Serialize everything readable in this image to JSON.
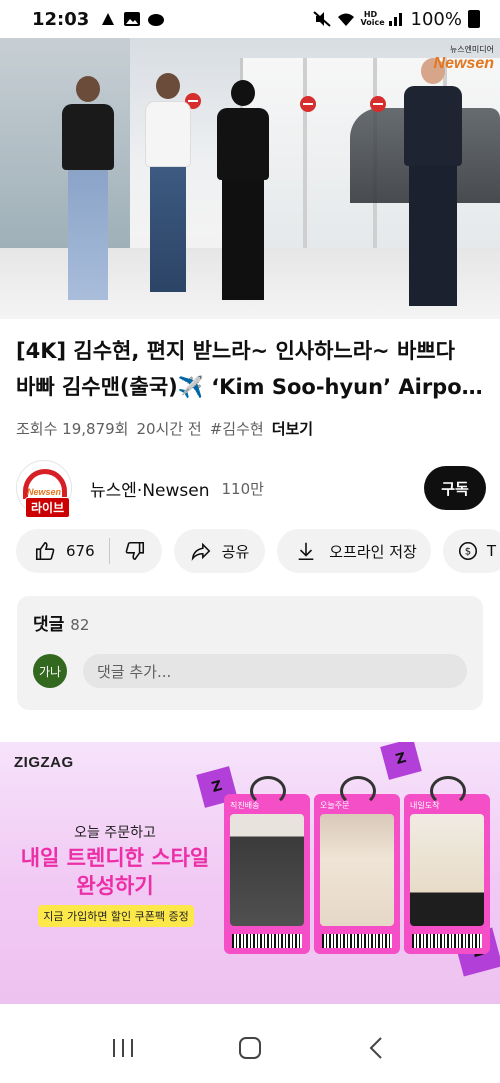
{
  "status_bar": {
    "time": "12:03",
    "battery": "100%",
    "network_badge": "HD Voice"
  },
  "video": {
    "watermark_small": "뉴스엔미디어",
    "watermark_brand": "Newsen"
  },
  "video_info": {
    "title_line1": "[4K] 김수현, 편지 받느라~ 인사하느라~ 바쁘다",
    "title_line2": "바빠 김수맨(출국)✈️ ‘Kim Soo-hyun’ Airpor...",
    "views": "조회수 19,879회",
    "time_ago": "20시간 전",
    "hashtag": "#김수현",
    "more_label": "더보기"
  },
  "channel": {
    "avatar_text": "Newsen",
    "live_badge": "라이브",
    "name": "뉴스엔·Newsen",
    "subscribers": "110만",
    "subscribe_label": "구독"
  },
  "actions": {
    "like_count": "676",
    "share_label": "공유",
    "download_label": "오프라인 저장",
    "thanks_label": "T"
  },
  "comments": {
    "header": "댓글",
    "count": "82",
    "user_avatar_text": "가나",
    "input_placeholder": "댓글 추가..."
  },
  "ad": {
    "brand": "ZIGZAG",
    "line1": "오늘 주문하고",
    "line2": "내일 트렌디한 스타일",
    "line3": "완성하기",
    "cta": "지금 가입하면 할인 쿠폰팩 증정",
    "ticket_tags": [
      "직진배송",
      "오늘주문",
      "내일도착"
    ],
    "accent_color": "#ec2fa7"
  },
  "navbar": {
    "icons": [
      "recent-apps-icon",
      "home-icon",
      "back-icon"
    ]
  }
}
